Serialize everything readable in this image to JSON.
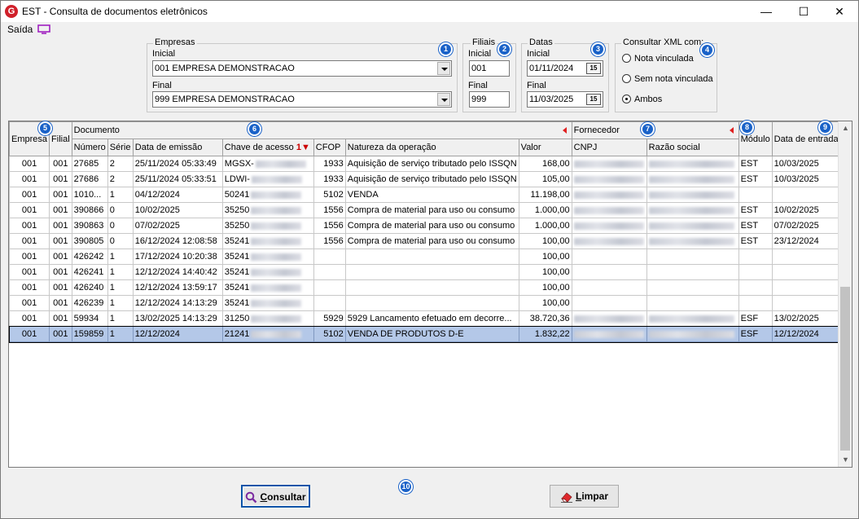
{
  "window": {
    "title": "EST - Consulta de documentos eletrônicos",
    "minimize": "—",
    "maximize": "☐",
    "close": "✕"
  },
  "menu": {
    "saida": "Saída"
  },
  "empresas": {
    "legend": "Empresas",
    "inicial_label": "Inicial",
    "inicial_value": "001 EMPRESA DEMONSTRACAO",
    "final_label": "Final",
    "final_value": "999 EMPRESA DEMONSTRACAO"
  },
  "filiais": {
    "legend": "Filiais",
    "inicial_label": "Inicial",
    "inicial_value": "001",
    "final_label": "Final",
    "final_value": "999"
  },
  "datas": {
    "legend": "Datas",
    "inicial_label": "Inicial",
    "inicial_value": "01/11/2024",
    "final_label": "Final",
    "final_value": "11/03/2025",
    "cal_icon": "15"
  },
  "xml": {
    "legend": "Consultar XML com:",
    "options": [
      "Nota vinculada",
      "Sem nota vinculada",
      "Ambos"
    ],
    "selected": "Ambos"
  },
  "badges": [
    "1",
    "2",
    "3",
    "4",
    "5",
    "6",
    "7",
    "8",
    "9",
    "10"
  ],
  "grid": {
    "group_headers": {
      "documento": "Documento",
      "fornecedor": "Fornecedor"
    },
    "columns": {
      "empresa": "Empresa",
      "filial": "Filial",
      "numero": "Número",
      "serie": "Série",
      "data_emissao": "Data de emissão",
      "chave": "Chave de acesso",
      "sort_index": "1",
      "cfop": "CFOP",
      "natureza": "Natureza da operação",
      "valor": "Valor",
      "cnpj": "CNPJ",
      "razao": "Razão social",
      "modulo": "Módulo",
      "data_entrada": "Data de entrada"
    },
    "rows": [
      {
        "empresa": "001",
        "filial": "001",
        "numero": "27685",
        "serie": "2",
        "emissao": "25/11/2024 05:33:49",
        "chave": "MGSX-",
        "cfop": "1933",
        "natureza": "Aquisição de serviço tributado pelo ISSQN",
        "valor": "168,00",
        "modulo": "EST",
        "entrada": "10/03/2025",
        "has_cnpj": true
      },
      {
        "empresa": "001",
        "filial": "001",
        "numero": "27686",
        "serie": "2",
        "emissao": "25/11/2024 05:33:51",
        "chave": "LDWI-",
        "cfop": "1933",
        "natureza": "Aquisição de serviço tributado pelo ISSQN",
        "valor": "105,00",
        "modulo": "EST",
        "entrada": "10/03/2025",
        "has_cnpj": true
      },
      {
        "empresa": "001",
        "filial": "001",
        "numero": "1010...",
        "serie": "1",
        "emissao": "04/12/2024",
        "chave": "50241",
        "cfop": "5102",
        "natureza": "VENDA",
        "valor": "11.198,00",
        "modulo": "",
        "entrada": "",
        "has_cnpj": true
      },
      {
        "empresa": "001",
        "filial": "001",
        "numero": "390866",
        "serie": "0",
        "emissao": "10/02/2025",
        "chave": "35250",
        "cfop": "1556",
        "natureza": "Compra de material para uso ou consumo",
        "valor": "1.000,00",
        "modulo": "EST",
        "entrada": "10/02/2025",
        "has_cnpj": true
      },
      {
        "empresa": "001",
        "filial": "001",
        "numero": "390863",
        "serie": "0",
        "emissao": "07/02/2025",
        "chave": "35250",
        "cfop": "1556",
        "natureza": "Compra de material para uso ou consumo",
        "valor": "1.000,00",
        "modulo": "EST",
        "entrada": "07/02/2025",
        "has_cnpj": true
      },
      {
        "empresa": "001",
        "filial": "001",
        "numero": "390805",
        "serie": "0",
        "emissao": "16/12/2024 12:08:58",
        "chave": "35241",
        "cfop": "1556",
        "natureza": "Compra de material para uso ou consumo",
        "valor": "100,00",
        "modulo": "EST",
        "entrada": "23/12/2024",
        "has_cnpj": true
      },
      {
        "empresa": "001",
        "filial": "001",
        "numero": "426242",
        "serie": "1",
        "emissao": "17/12/2024 10:20:38",
        "chave": "35241",
        "cfop": "",
        "natureza": "",
        "valor": "100,00",
        "modulo": "",
        "entrada": "",
        "has_cnpj": false
      },
      {
        "empresa": "001",
        "filial": "001",
        "numero": "426241",
        "serie": "1",
        "emissao": "12/12/2024 14:40:42",
        "chave": "35241",
        "cfop": "",
        "natureza": "",
        "valor": "100,00",
        "modulo": "",
        "entrada": "",
        "has_cnpj": false
      },
      {
        "empresa": "001",
        "filial": "001",
        "numero": "426240",
        "serie": "1",
        "emissao": "12/12/2024 13:59:17",
        "chave": "35241",
        "cfop": "",
        "natureza": "",
        "valor": "100,00",
        "modulo": "",
        "entrada": "",
        "has_cnpj": false
      },
      {
        "empresa": "001",
        "filial": "001",
        "numero": "426239",
        "serie": "1",
        "emissao": "12/12/2024 14:13:29",
        "chave": "35241",
        "cfop": "",
        "natureza": "",
        "valor": "100,00",
        "modulo": "",
        "entrada": "",
        "has_cnpj": false
      },
      {
        "empresa": "001",
        "filial": "001",
        "numero": "59934",
        "serie": "1",
        "emissao": "13/02/2025 14:13:29",
        "chave": "31250",
        "cfop": "5929",
        "natureza": "5929 Lancamento efetuado em decorre...",
        "valor": "38.720,36",
        "modulo": "ESF",
        "entrada": "13/02/2025",
        "has_cnpj": true
      },
      {
        "empresa": "001",
        "filial": "001",
        "numero": "159859",
        "serie": "1",
        "emissao": "12/12/2024",
        "chave": "21241",
        "cfop": "5102",
        "natureza": "VENDA DE PRODUTOS D-E",
        "valor": "1.832,22",
        "modulo": "ESF",
        "entrada": "12/12/2024",
        "has_cnpj": true,
        "selected": true
      }
    ]
  },
  "buttons": {
    "consultar": "onsultar",
    "consultar_ul": "C",
    "limpar": "impar",
    "limpar_ul": "L"
  }
}
